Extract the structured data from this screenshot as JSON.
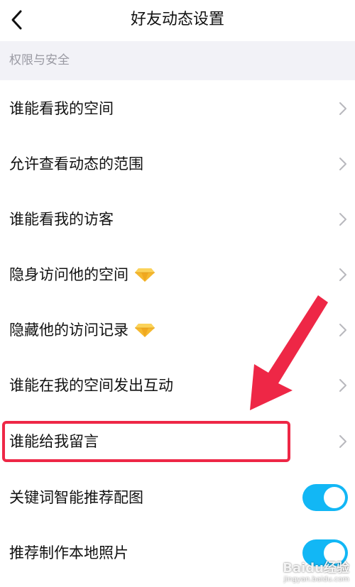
{
  "header": {
    "title": "好友动态设置",
    "back_icon": "chevron-left-icon"
  },
  "section": {
    "label": "权限与安全"
  },
  "rows": [
    {
      "label": "谁能看我的空间",
      "control": "chevron"
    },
    {
      "label": "允许查看动态的范围",
      "control": "chevron"
    },
    {
      "label": "谁能看我的访客",
      "control": "chevron"
    },
    {
      "label": "隐身访问他的空间",
      "control": "chevron",
      "badge": "diamond-vip-icon"
    },
    {
      "label": "隐藏他的访问记录",
      "control": "chevron",
      "badge": "diamond-vip-icon"
    },
    {
      "label": "谁能在我的空间发出互动",
      "control": "chevron"
    },
    {
      "label": "谁能给我留言",
      "control": "chevron",
      "highlighted": true
    },
    {
      "label": "关键词智能推荐配图",
      "control": "toggle",
      "on": true
    },
    {
      "label": "推荐制作本地照片",
      "control": "toggle",
      "on": true
    }
  ],
  "annotation": {
    "color": "#ee2746",
    "arrow_points_to": "谁能给我留言"
  },
  "watermark": {
    "main": "Baidu经验",
    "sub": "jingyan.baidu.com"
  },
  "colors": {
    "toggle_on": "#12b7f5",
    "section_bg": "#f2f2f7",
    "section_text": "#9a9aa3",
    "chevron": "#b8b8bd",
    "diamond": "#f5b82e",
    "highlight": "#ee2746"
  }
}
